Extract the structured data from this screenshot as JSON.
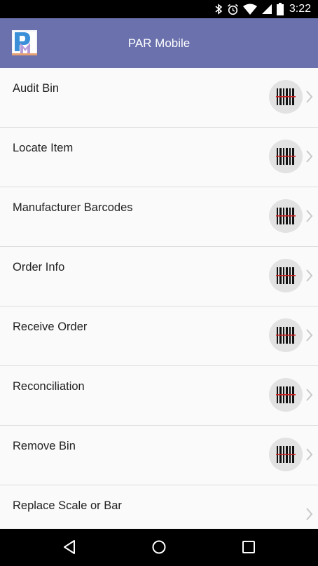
{
  "status_bar": {
    "time": "3:22",
    "icons": [
      "bluetooth-icon",
      "alarm-icon",
      "wifi-icon",
      "cell-signal-icon",
      "battery-icon"
    ]
  },
  "app_bar": {
    "title": "PAR Mobile",
    "logo_icon": "par-logo-icon"
  },
  "menu": {
    "items": [
      {
        "label": "Audit Bin",
        "has_scan": true
      },
      {
        "label": "Locate Item",
        "has_scan": true
      },
      {
        "label": "Manufacturer Barcodes",
        "has_scan": true
      },
      {
        "label": "Order Info",
        "has_scan": true
      },
      {
        "label": "Receive Order",
        "has_scan": true
      },
      {
        "label": "Reconciliation",
        "has_scan": true
      },
      {
        "label": "Remove Bin",
        "has_scan": true
      },
      {
        "label": "Replace Scale or Bar",
        "has_scan": false
      }
    ],
    "scan_icon": "barcode-scan-icon",
    "chevron_icon": "chevron-right-icon"
  },
  "nav_bar": {
    "back_icon": "back-icon",
    "home_icon": "home-icon",
    "recents_icon": "recents-icon"
  },
  "colors": {
    "app_bar": "#6a71ad",
    "background": "#fafafa",
    "divider": "#dddddd",
    "scan_circle": "#e2e2e2",
    "scan_line": "#cc1f1f"
  }
}
